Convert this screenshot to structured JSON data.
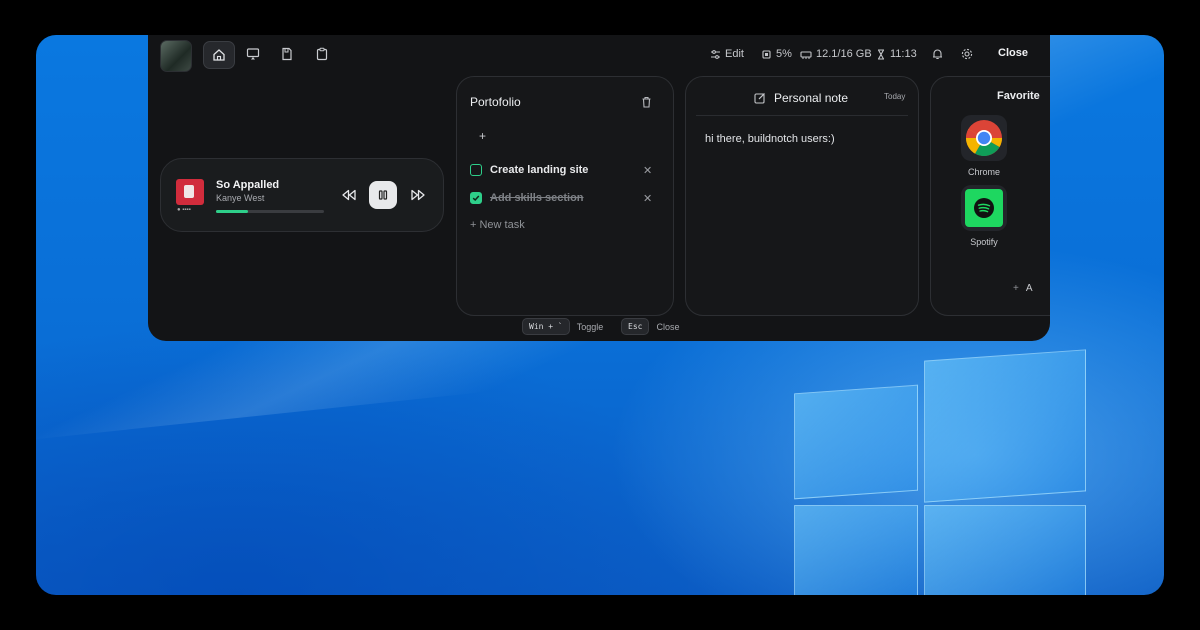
{
  "toolbar": {
    "edit_label": "Edit",
    "cpu": "5%",
    "memory": "12.1/16 GB",
    "time": "11:13",
    "close_label": "Close"
  },
  "media": {
    "title": "So Appalled",
    "artist": "Kanye West",
    "progress": 0.3,
    "source": "Spotify"
  },
  "todo": {
    "title": "Portofolio",
    "add_symbol": "+",
    "tasks": [
      {
        "label": "Create landing site",
        "done": false
      },
      {
        "label": "Add skills section",
        "done": true
      }
    ],
    "new_task_label": "+ New task"
  },
  "note": {
    "title": "Personal note",
    "date": "Today",
    "body": "hi there, buildnotch users:)"
  },
  "favorites": {
    "title": "Favorite",
    "apps": [
      {
        "label": "Chrome",
        "icon": "chrome-icon"
      },
      {
        "label": "Spotify",
        "icon": "spotify-icon"
      }
    ],
    "add_label": "A"
  },
  "hints": {
    "toggle_key": "Win + `",
    "toggle_label": "Toggle",
    "close_key": "Esc",
    "close_label": "Close"
  },
  "colors": {
    "accent": "#2ecf8a",
    "panel": "#131416",
    "wallpaper": "#0a78e0"
  }
}
